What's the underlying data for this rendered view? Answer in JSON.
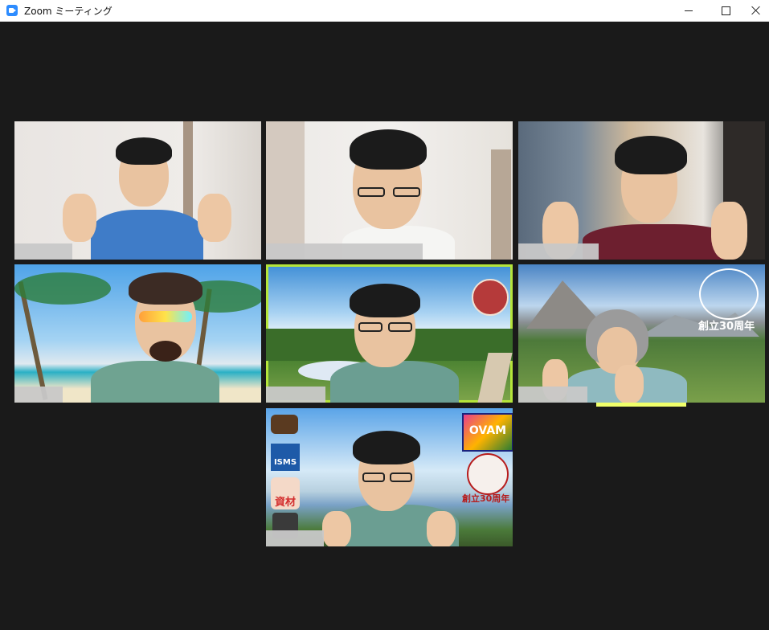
{
  "window": {
    "title": "Zoom ミーティング"
  },
  "colors": {
    "background": "#1a1a1a",
    "active_speaker_border": "#b5e53a",
    "name_bar": "#c8c8c8"
  },
  "tiles": [
    {
      "id": "tile-1",
      "background": "room-wall",
      "overlay_text": ""
    },
    {
      "id": "tile-2",
      "background": "room-door",
      "overlay_text": ""
    },
    {
      "id": "tile-3",
      "background": "room-closet",
      "overlay_text": ""
    },
    {
      "id": "tile-4",
      "background": "tropical-beach",
      "overlay_text": ""
    },
    {
      "id": "tile-5",
      "background": "mountain-marsh",
      "overlay_text": "",
      "active_speaker": true
    },
    {
      "id": "tile-6",
      "background": "alpine-meadow",
      "overlay_text": "創立30周年"
    },
    {
      "id": "tile-7",
      "background": "sky-landscape",
      "overlay_text": ""
    }
  ],
  "tile7_badges": {
    "isms": "ISMS",
    "shizai": "資材",
    "ovam": "OVAM",
    "anniversary": "創立30周年"
  }
}
